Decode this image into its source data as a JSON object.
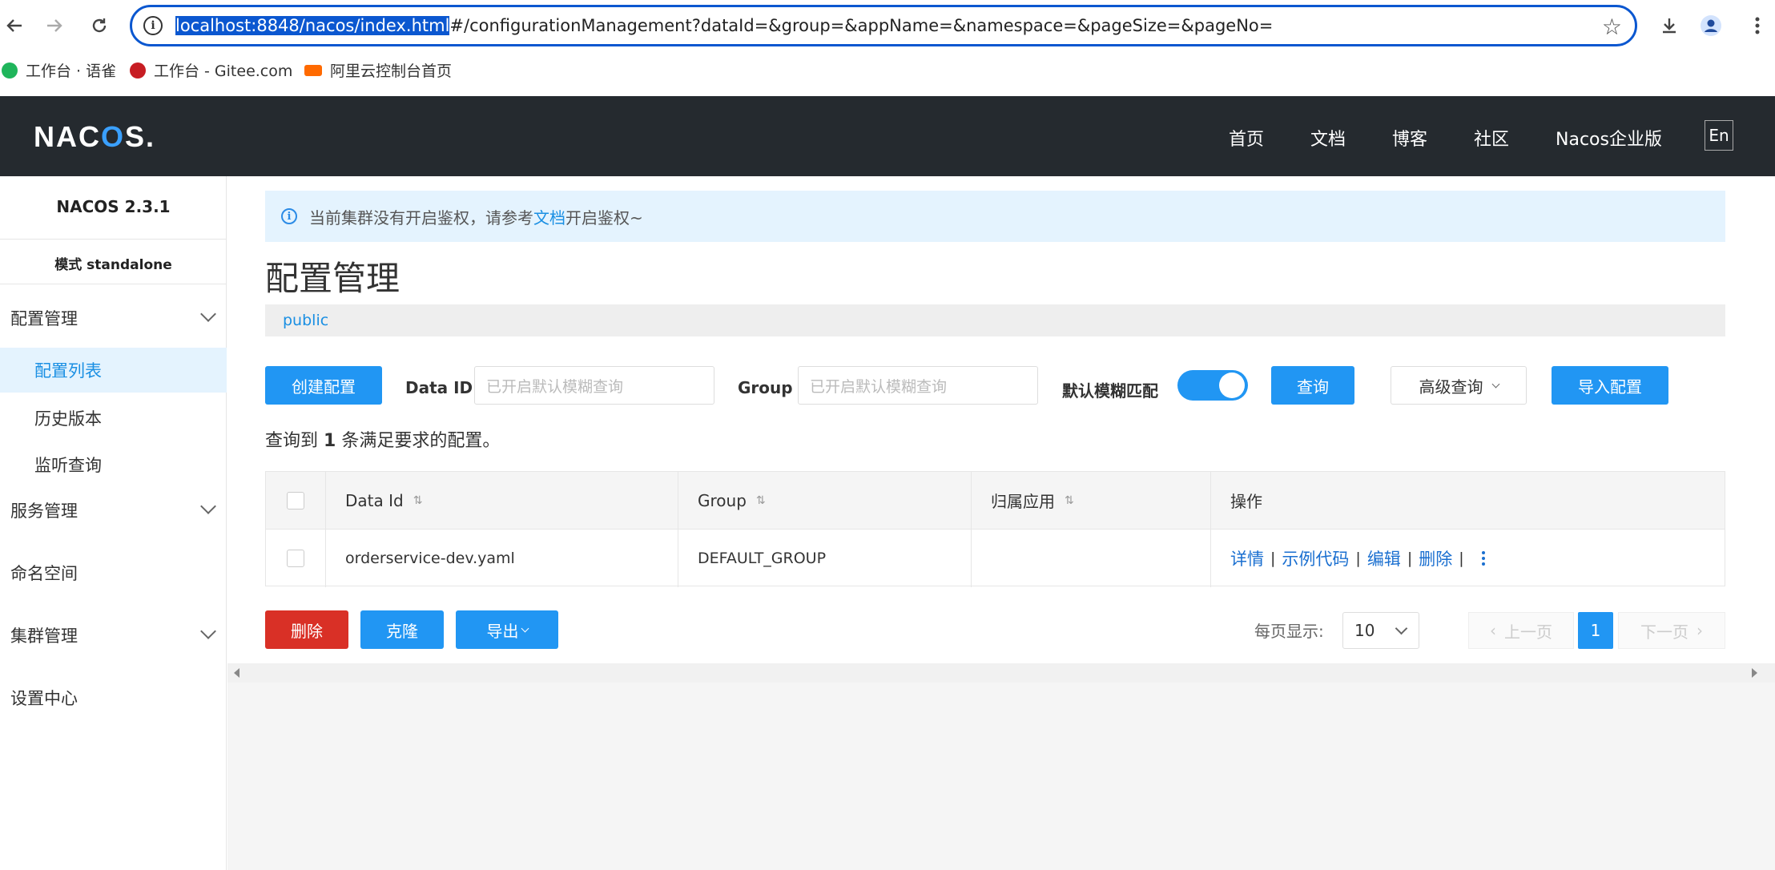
{
  "browser": {
    "url_selected": "localhost:8848/nacos/index.html",
    "url_rest": "#/configurationManagement?dataId=&group=&appName=&namespace=&pageSize=&pageNo=",
    "bookmarks": [
      {
        "label": "工作台 · 语雀",
        "color": "#1fb55b"
      },
      {
        "label": "工作台 - Gitee.com",
        "color": "#c71d23"
      },
      {
        "label": "阿里云控制台首页",
        "color": "#ff6a00"
      }
    ]
  },
  "header": {
    "logo_pre": "NAC",
    "logo_o": "O",
    "logo_post": "S.",
    "nav": [
      "首页",
      "文档",
      "博客",
      "社区",
      "Nacos企业版"
    ],
    "lang": "En"
  },
  "sidebar": {
    "version": "NACOS 2.3.1",
    "mode": "模式 standalone",
    "items": [
      {
        "label": "配置管理",
        "expandable": true
      },
      {
        "label": "配置列表",
        "active": true
      },
      {
        "label": "历史版本"
      },
      {
        "label": "监听查询"
      },
      {
        "label": "服务管理",
        "expandable": true
      },
      {
        "label": "命名空间"
      },
      {
        "label": "集群管理",
        "expandable": true
      },
      {
        "label": "设置中心"
      }
    ]
  },
  "notice": {
    "text_before": "当前集群没有开启鉴权，请参考",
    "link": "文档",
    "text_after": "开启鉴权~"
  },
  "page_title": "配置管理",
  "namespace": "public",
  "toolbar": {
    "create_label": "创建配置",
    "dataid_label": "Data ID",
    "dataid_placeholder": "已开启默认模糊查询",
    "group_label": "Group",
    "group_placeholder": "已开启默认模糊查询",
    "fuzzy_label": "默认模糊匹配",
    "fuzzy_on": true,
    "query_label": "查询",
    "advanced_label": "高级查询",
    "import_label": "导入配置"
  },
  "result": {
    "prefix": "查询到",
    "count": "1",
    "suffix": "条满足要求的配置。"
  },
  "table": {
    "headers": [
      "Data Id",
      "Group",
      "归属应用",
      "操作"
    ],
    "rows": [
      {
        "data_id": "orderservice-dev.yaml",
        "group": "DEFAULT_GROUP",
        "app": "",
        "actions": [
          "详情",
          "示例代码",
          "编辑",
          "删除"
        ]
      }
    ]
  },
  "bulk": {
    "delete_label": "删除",
    "clone_label": "克隆",
    "export_label": "导出"
  },
  "pagination": {
    "per_page_label": "每页显示:",
    "per_page": "10",
    "prev_label": "上一页",
    "current": "1",
    "next_label": "下一页"
  }
}
